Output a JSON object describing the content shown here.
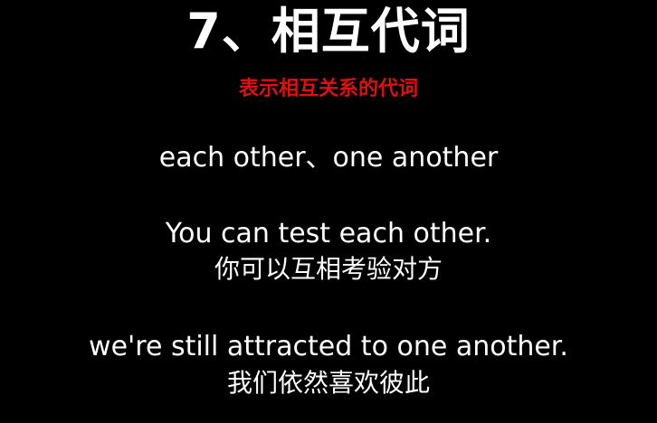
{
  "title": "7、相互代词",
  "subtitle": "表示相互关系的代词",
  "phrase": "each other、one another",
  "examples": [
    {
      "en": "You can test each other.",
      "zh": "你可以互相考验对方"
    },
    {
      "en": "we're still attracted to one another.",
      "zh": "我们依然喜欢彼此"
    }
  ],
  "colors": {
    "background": "#000000",
    "text": "#ffffff",
    "subtitle": "#e01010"
  }
}
